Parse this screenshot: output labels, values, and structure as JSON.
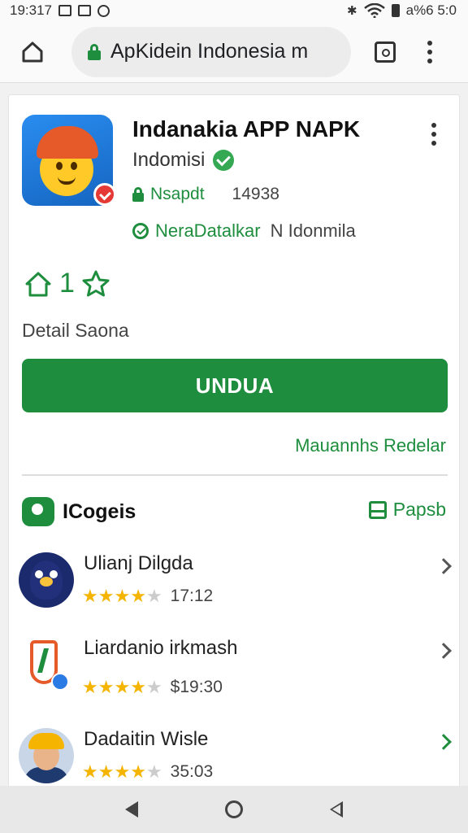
{
  "status_bar": {
    "time": "19:317",
    "battery": "a%6 5:0"
  },
  "browser": {
    "url": "ApKidein Indonesia m"
  },
  "app": {
    "title": "Indanakia APP NAPK",
    "developer": "Indomisi",
    "safe_label": "Nsapdt",
    "safe_count": "14938",
    "region_label": "NeraDatalkar",
    "region_value": "N Idonmila",
    "rating": "1",
    "detail_text": "Detail Saona",
    "install_label": "UNDUA",
    "more_link": "Mauannhs Redelar"
  },
  "section": {
    "title": "ICogeis",
    "action_label": "Papsb"
  },
  "list": [
    {
      "name": "Ulianj Dilgda",
      "count": "17:12",
      "stars": 4.5
    },
    {
      "name": "Liardanio irkmash",
      "count": "$19:30",
      "stars": 4.5
    },
    {
      "name": "Dadaitin Wisle",
      "count": "35:03",
      "stars": 4.5
    }
  ],
  "colors": {
    "accent": "#1e8e3e",
    "star": "#f4b400"
  },
  "icons": [
    "wifi-icon",
    "bluetooth-icon",
    "battery-icon",
    "home-icon",
    "lock-icon",
    "tabs-icon",
    "menu-icon",
    "verified-icon",
    "star-icon",
    "chevron-right-icon",
    "back-icon",
    "home-nav-icon",
    "recents-icon"
  ]
}
